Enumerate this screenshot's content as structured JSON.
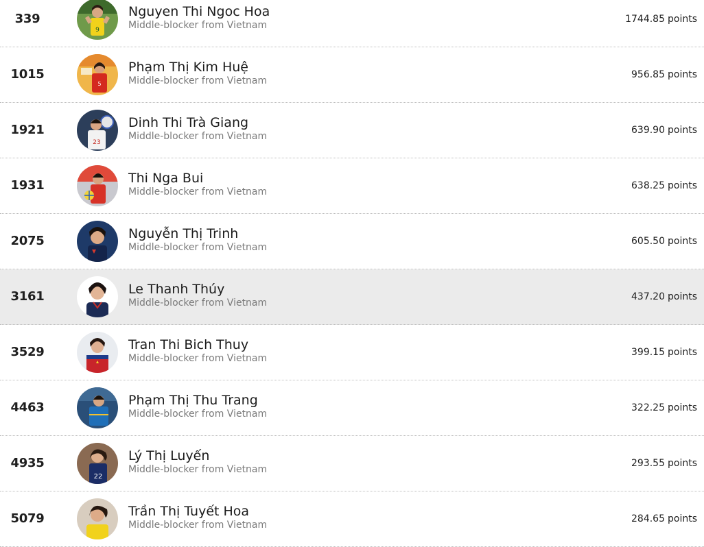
{
  "ranking": {
    "subtitle_template": "Middle-blocker from Vietnam",
    "points_unit": "points",
    "rows": [
      {
        "rank": "339",
        "name": "Nguyen Thi Ngoc Hoa",
        "subtitle": "Middle-blocker from Vietnam",
        "points": "1744.85",
        "unit": "points",
        "highlighted": false
      },
      {
        "rank": "1015",
        "name": "Phạm Thị Kim Huệ",
        "subtitle": "Middle-blocker from Vietnam",
        "points": "956.85",
        "unit": "points",
        "highlighted": false
      },
      {
        "rank": "1921",
        "name": "Dinh Thi Trà Giang",
        "subtitle": "Middle-blocker from Vietnam",
        "points": "639.90",
        "unit": "points",
        "highlighted": false
      },
      {
        "rank": "1931",
        "name": "Thi Nga Bui",
        "subtitle": "Middle-blocker from Vietnam",
        "points": "638.25",
        "unit": "points",
        "highlighted": false
      },
      {
        "rank": "2075",
        "name": "Nguyễn Thị Trinh",
        "subtitle": "Middle-blocker from Vietnam",
        "points": "605.50",
        "unit": "points",
        "highlighted": false
      },
      {
        "rank": "3161",
        "name": "Le Thanh Thúy",
        "subtitle": "Middle-blocker from Vietnam",
        "points": "437.20",
        "unit": "points",
        "highlighted": true
      },
      {
        "rank": "3529",
        "name": "Tran Thi Bich Thuy",
        "subtitle": "Middle-blocker from Vietnam",
        "points": "399.15",
        "unit": "points",
        "highlighted": false
      },
      {
        "rank": "4463",
        "name": "Phạm Thị Thu Trang",
        "subtitle": "Middle-blocker from Vietnam",
        "points": "322.25",
        "unit": "points",
        "highlighted": false
      },
      {
        "rank": "4935",
        "name": "Lý Thị Luyến",
        "subtitle": "Middle-blocker from Vietnam",
        "points": "293.55",
        "unit": "points",
        "highlighted": false
      },
      {
        "rank": "5079",
        "name": "Trần Thị Tuyết Hoa",
        "subtitle": "Middle-blocker from Vietnam",
        "points": "284.65",
        "unit": "points",
        "highlighted": false
      }
    ]
  },
  "colors": {
    "row_highlight": "#ebebeb",
    "separator": "#bdbdbd",
    "subtitle": "#7a7a7a",
    "text": "#1f1f1f"
  }
}
